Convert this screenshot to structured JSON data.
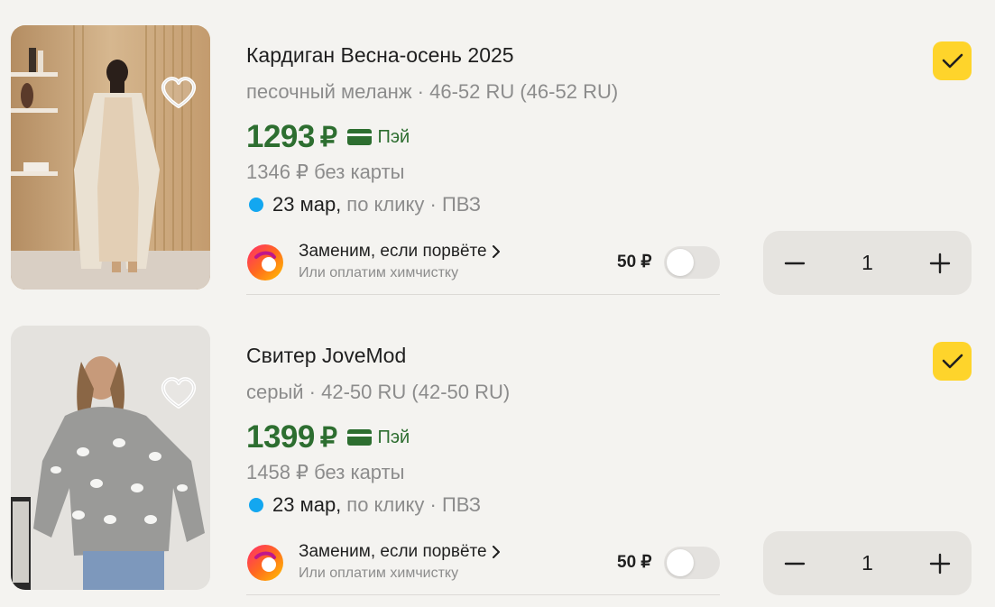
{
  "items": [
    {
      "title": "Кардиган Весна-осень 2025",
      "variant": "песочный меланж · 46-52 RU (46-52 RU)",
      "price": "1293",
      "currency": "₽",
      "pay_label": "Пэй",
      "no_card_price": "1346 ₽ без карты",
      "delivery_date": "23 мар,",
      "delivery_rest": "по клику · ПВЗ",
      "insurance_title": "Заменим, если порвёте",
      "insurance_subtitle": "Или оплатим химчистку",
      "insurance_price": "50 ₽",
      "insurance_enabled": false,
      "quantity": "1",
      "selected": true,
      "favorite": false,
      "image_alt": "woman in beige cardigan and satin dress"
    },
    {
      "title": "Свитер JoveMod",
      "variant": "серый · 42-50 RU (42-50 RU)",
      "price": "1399",
      "currency": "₽",
      "pay_label": "Пэй",
      "no_card_price": "1458 ₽ без карты",
      "delivery_date": "23 мар,",
      "delivery_rest": "по клику · ПВЗ",
      "insurance_title": "Заменим, если порвёте",
      "insurance_subtitle": "Или оплатим химчистку",
      "insurance_price": "50 ₽",
      "insurance_enabled": false,
      "quantity": "1",
      "selected": true,
      "favorite": false,
      "image_alt": "woman in grey sheep-pattern sweater"
    }
  ],
  "colors": {
    "price_green": "#2d6e30",
    "checkbox_yellow": "#fed42b",
    "delivery_dot": "#13a7f0",
    "background": "#f4f3f0"
  },
  "icons": {
    "favorite": "heart-outline-icon",
    "pay": "card-icon",
    "checkbox": "checkmark-icon",
    "minus": "minus-icon",
    "plus": "plus-icon",
    "insurance": "insurance-logo",
    "chevron": "chevron-right-icon"
  }
}
